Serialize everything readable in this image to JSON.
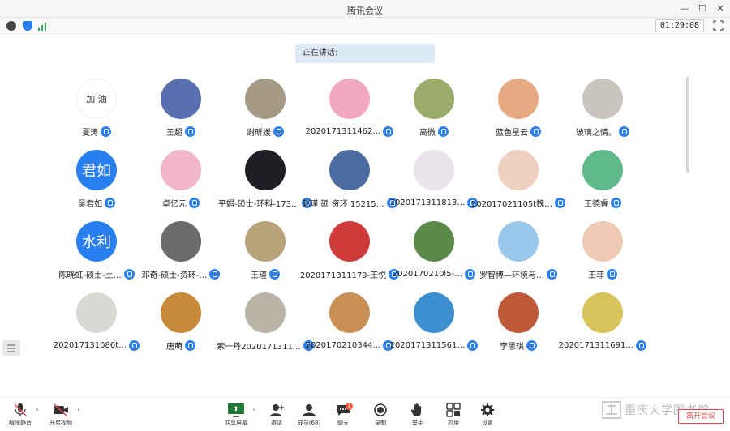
{
  "window": {
    "title": "腾讯会议"
  },
  "header": {
    "timer": "01:29:08",
    "speaking": "正在讲话:"
  },
  "participants": [
    {
      "name": "夏涛",
      "avatar_text": "加 油",
      "bg": "#ffffff",
      "fg": "#333333"
    },
    {
      "name": "王超",
      "avatar_text": "",
      "bg": "#5a6fb0",
      "fg": "#ffffff"
    },
    {
      "name": "谢昕媛",
      "avatar_text": "",
      "bg": "#a59a86",
      "fg": "#ffffff"
    },
    {
      "name": "2020171311462…",
      "avatar_text": "",
      "bg": "#f2a9c0",
      "fg": "#ffffff"
    },
    {
      "name": "高微",
      "avatar_text": "",
      "bg": "#9aab6a",
      "fg": "#ffffff"
    },
    {
      "name": "蓝色星云",
      "avatar_text": "",
      "bg": "#e7a982",
      "fg": "#ffffff"
    },
    {
      "name": "玻璃之情。",
      "avatar_text": "",
      "bg": "#c9c4bd",
      "fg": "#ffffff"
    },
    {
      "name": "吴君如",
      "avatar_text": "君如",
      "bg": "#2a7ff0",
      "fg": "#ffffff"
    },
    {
      "name": "卓亿元",
      "avatar_text": "",
      "bg": "#f1b6c8",
      "fg": "#ffffff"
    },
    {
      "name": "平娟-硕士-环科-173…",
      "avatar_text": "",
      "bg": "#1e1e24",
      "fg": "#ffffff"
    },
    {
      "name": "郭瑾 硕 资环 15215…",
      "avatar_text": "",
      "bg": "#4d6da0",
      "fg": "#ffffff"
    },
    {
      "name": "2020171311813…",
      "avatar_text": "",
      "bg": "#e8e4ea",
      "fg": "#ffffff"
    },
    {
      "name": "202017021105t魏…",
      "avatar_text": "",
      "bg": "#eecfc0",
      "fg": "#ffffff"
    },
    {
      "name": "王德睿",
      "avatar_text": "",
      "bg": "#5fb98a",
      "fg": "#ffffff"
    },
    {
      "name": "陈晓虹-硕士-土…",
      "avatar_text": "水利",
      "bg": "#2a7ff0",
      "fg": "#ffffff"
    },
    {
      "name": "邓奇-硕士-资环-…",
      "avatar_text": "",
      "bg": "#6b6b6b",
      "fg": "#ffffff"
    },
    {
      "name": "王瑾",
      "avatar_text": "",
      "bg": "#b7a27a",
      "fg": "#ffffff"
    },
    {
      "name": "2020171311179-王悦",
      "avatar_text": "",
      "bg": "#cf3b3b",
      "fg": "#ffffff"
    },
    {
      "name": "2020170210l5-…",
      "avatar_text": "",
      "bg": "#5c8a4a",
      "fg": "#ffffff"
    },
    {
      "name": "罗智博—环境与…",
      "avatar_text": "",
      "bg": "#9ac8ec",
      "fg": "#ffffff"
    },
    {
      "name": "王菲",
      "avatar_text": "",
      "bg": "#eec9b4",
      "fg": "#ffffff"
    },
    {
      "name": "202017131086t…",
      "avatar_text": "",
      "bg": "#d9d9d4",
      "fg": "#ffffff"
    },
    {
      "name": "唐萌",
      "avatar_text": "",
      "bg": "#c68a3a",
      "fg": "#ffffff"
    },
    {
      "name": "索一丹2020171311…",
      "avatar_text": "",
      "bg": "#b9b3a8",
      "fg": "#ffffff"
    },
    {
      "name": "2020170210344…",
      "avatar_text": "",
      "bg": "#c99055",
      "fg": "#ffffff"
    },
    {
      "name": "2020171311561…",
      "avatar_text": "",
      "bg": "#3d8fd0",
      "fg": "#ffffff"
    },
    {
      "name": "李思琪",
      "avatar_text": "",
      "bg": "#bd5a3a",
      "fg": "#ffffff"
    },
    {
      "name": "2020171311691…",
      "avatar_text": "",
      "bg": "#d7c35a",
      "fg": "#ffffff"
    }
  ],
  "bottombar": {
    "mute": "解除静音",
    "video": "开启视频",
    "share": "共享屏幕",
    "invite": "邀请",
    "members": "成员(68)",
    "chat": "聊天",
    "chat_badge": "1",
    "record": "录制",
    "hand": "举手",
    "apps": "应用",
    "settings": "设置",
    "watermark": "重庆大学图书馆",
    "leave": "离开会议"
  },
  "colors": {
    "accent": "#2a7ff0",
    "leave": "#e04848"
  }
}
